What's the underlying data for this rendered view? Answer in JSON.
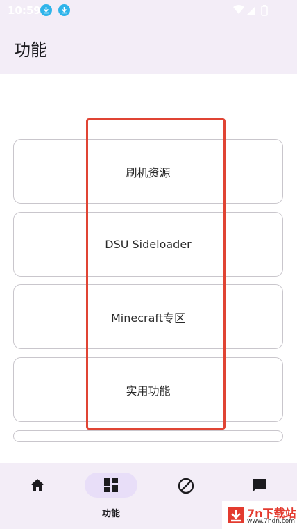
{
  "status_bar": {
    "time": "10:59"
  },
  "app_bar": {
    "title": "功能"
  },
  "cards": [
    {
      "label": "刷机资源"
    },
    {
      "label": "DSU Sideloader"
    },
    {
      "label": "Minecraft专区"
    },
    {
      "label": "实用功能"
    },
    {
      "label": ""
    }
  ],
  "bottom_nav": {
    "items": [
      {
        "icon": "home-icon",
        "label": ""
      },
      {
        "icon": "dashboard-icon",
        "label": "功能"
      },
      {
        "icon": "block-icon",
        "label": ""
      },
      {
        "icon": "chat-icon",
        "label": ""
      }
    ]
  },
  "watermark": {
    "brand": "7n下载站",
    "url": "www.7ndn.com"
  },
  "colors": {
    "highlight": "#e04434",
    "nav_selected": "#e8def8",
    "surface": "#f3edf7"
  }
}
